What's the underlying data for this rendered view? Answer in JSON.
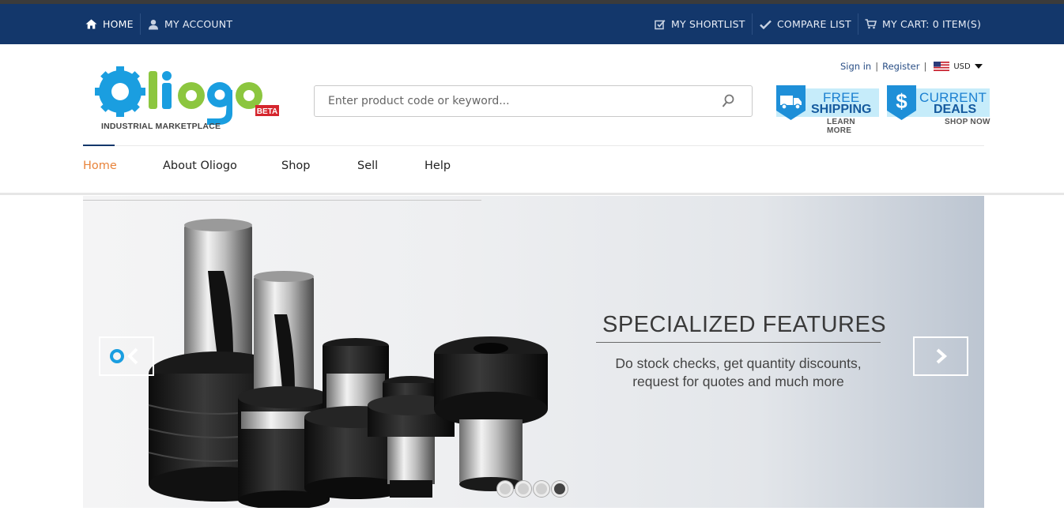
{
  "topbar": {
    "home": "HOME",
    "my_account": "MY ACCOUNT",
    "shortlist": "MY SHORTLIST",
    "compare": "COMPARE LIST",
    "cart": "MY CART: 0 ITEM(S)"
  },
  "brand": {
    "logo_text": "Oliogo",
    "tagline": "INDUSTRIAL MARKETPLACE",
    "badge": "BETA",
    "colors": {
      "blue": "#1a9ee0",
      "green": "#8cc63f",
      "badge": "#d5262e"
    }
  },
  "search": {
    "placeholder": "Enter product code or keyword..."
  },
  "account": {
    "sign_in": "Sign in",
    "separator": "|",
    "register": "Register",
    "currency": "USD"
  },
  "promos": {
    "shipping": {
      "line1": "FREE",
      "line2": "SHIPPING",
      "cta": "LEARN MORE"
    },
    "deals": {
      "line1": "CURRENT",
      "line2": "DEALS",
      "cta": "SHOP NOW"
    }
  },
  "nav": {
    "items": [
      {
        "label": "Home",
        "active": true
      },
      {
        "label": "About Oliogo"
      },
      {
        "label": "Shop"
      },
      {
        "label": "Sell"
      },
      {
        "label": "Help"
      }
    ]
  },
  "slider": {
    "title": "SPECIALIZED FEATURES",
    "subtitle": "Do stock checks, get quantity discounts, request for quotes and much more",
    "slide_count": 4,
    "active_slide": 4
  },
  "icons": {
    "home": "home-icon",
    "user": "user-icon",
    "shortlist": "edit-check-icon",
    "compare": "check-icon",
    "cart": "cart-icon",
    "search": "search-icon",
    "flag": "us-flag-icon",
    "caret": "caret-down-icon",
    "truck": "truck-icon",
    "dollar": "dollar-icon",
    "prev": "chevron-left-icon",
    "next": "chevron-right-icon"
  },
  "colors": {
    "topbar": "#13376b",
    "nav_active": "#e8833a",
    "link": "#2a4f86",
    "promo_bg": "#c6ecfa"
  }
}
